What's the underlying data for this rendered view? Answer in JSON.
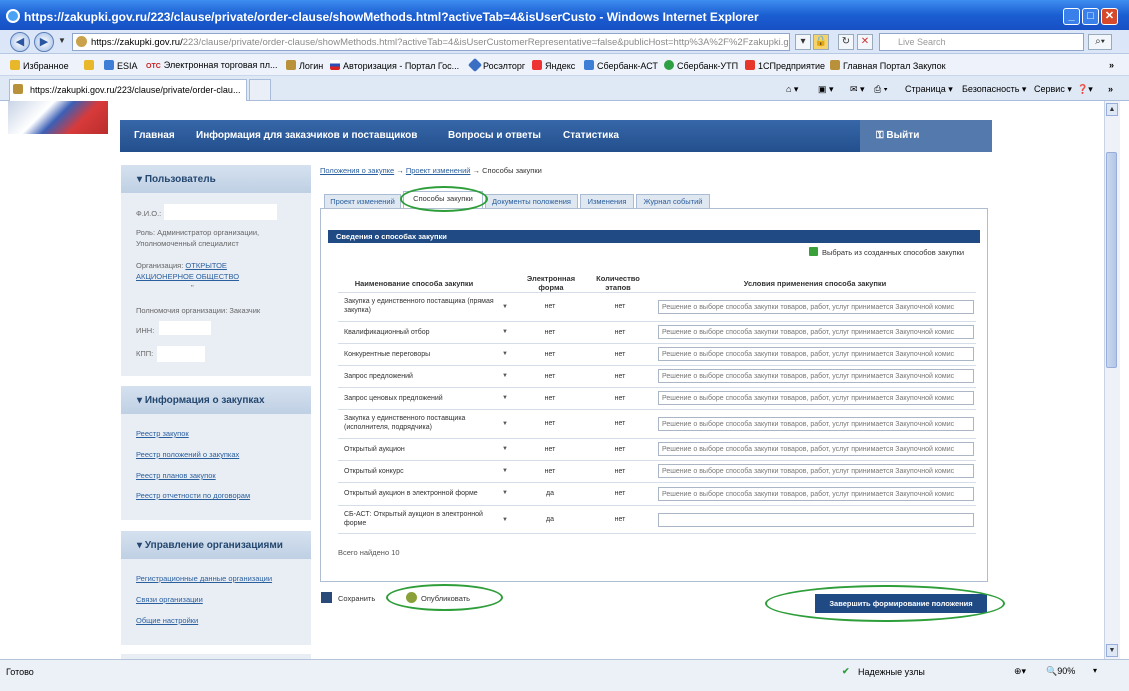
{
  "window": {
    "title": "https://zakupki.gov.ru/223/clause/private/order-clause/showMethods.html?activeTab=4&isUserCusto - Windows Internet Explorer"
  },
  "address": {
    "url_host": "https://zakupki.gov.ru/",
    "url_path": "223/clause/private/order-clause/showMethods.html?activeTab=4&isUserCustomerRepresentative=false&publicHost=http%3A%2F%2Fzakupki.gov.ru%2F223%",
    "search_placeholder": "Live Search"
  },
  "favorites": {
    "label": "Избранное",
    "items": [
      "ESIA",
      "Электронная торговая пл...",
      "Логин",
      "Авторизация - Портал Гос...",
      "Росэлторг",
      "Яндекс",
      "Сбербанк-АСТ",
      "Сбербанк-УТП",
      "1СПредприятие",
      "Главная Портал Закупок"
    ],
    "otc": "OTC"
  },
  "tab": {
    "label": "https://zakupki.gov.ru/223/clause/private/order-clau..."
  },
  "commandbar": {
    "page": "Страница",
    "security": "Безопасность",
    "service": "Сервис"
  },
  "nav": {
    "home": "Главная",
    "info": "Информация для заказчиков и поставщиков",
    "faq": "Вопросы и ответы",
    "stats": "Статистика",
    "logout": "Выйти"
  },
  "sidebar": {
    "user": {
      "title": "Пользователь",
      "fio": "Ф.И.О.:",
      "role": "Роль: Администратор организации, Уполномоченный специалист",
      "org_label": "Организация:",
      "org_link_1": "ОТКРЫТОЕ",
      "org_link_2": "АКЦИОНЕРНОЕ ОБЩЕСТВО",
      "org_tail": "\"",
      "authority": "Полномочия организации: Заказчик",
      "inn": "ИНН:",
      "kpp": "КПП:"
    },
    "procurement": {
      "title": "Информация о закупках",
      "links": [
        "Реестр закупок",
        "Реестр положений о закупках",
        "Реестр планов закупок",
        "Реестр отчетности по договорам"
      ]
    },
    "management": {
      "title": "Управление организациями",
      "links": [
        "Регистрационные данные организации",
        "Связи организации",
        "Общие настройки"
      ]
    }
  },
  "breadcrumb": {
    "item1": "Положения о закупке",
    "arrow": "→",
    "item2": "Проект изменений",
    "current": "Способы закупки"
  },
  "tabs": [
    "Проект изменений",
    "Способы закупки",
    "Документы положения",
    "Изменения",
    "Журнал событий"
  ],
  "section": {
    "title": "Сведения о способах закупки",
    "add_link": "Выбрать из созданных способов закупки"
  },
  "table": {
    "headers": {
      "name": "Наименование способа закупки",
      "electronic": "Электронная форма",
      "stages": "Количество этапов",
      "conditions": "Условия применения способа закупки"
    },
    "cond_text": "Решение о выборе способа закупки товаров, работ, услуг принимается Закупочной комис",
    "rows": [
      {
        "name": "Закупка у единственного поставщика (прямая закупка)",
        "electronic": "нет",
        "stages": "нет"
      },
      {
        "name": "Квалификационный отбор",
        "electronic": "нет",
        "stages": "нет"
      },
      {
        "name": "Конкурентные переговоры",
        "electronic": "нет",
        "stages": "нет"
      },
      {
        "name": "Запрос предложений",
        "electronic": "нет",
        "stages": "нет"
      },
      {
        "name": "Запрос ценовых предложений",
        "electronic": "нет",
        "stages": "нет"
      },
      {
        "name": "Закупка у единственного поставщика (исполнителя, подрядчика)",
        "electronic": "нет",
        "stages": "нет"
      },
      {
        "name": "Открытый аукцион",
        "electronic": "нет",
        "stages": "нет"
      },
      {
        "name": "Открытый конкурс",
        "electronic": "нет",
        "stages": "нет"
      },
      {
        "name": "Открытый аукцион в электронной форме",
        "electronic": "да",
        "stages": "нет"
      },
      {
        "name": "СБ-АСТ: Открытый аукцион в электронной форме",
        "electronic": "да",
        "stages": "нет"
      }
    ],
    "total": "Всего найдено 10"
  },
  "actions": {
    "save": "Сохранить",
    "publish": "Опубликовать",
    "finish": "Завершить формирование положения"
  },
  "status": {
    "text": "Готово",
    "zone": "Надежные узлы",
    "zoom": "90%"
  }
}
